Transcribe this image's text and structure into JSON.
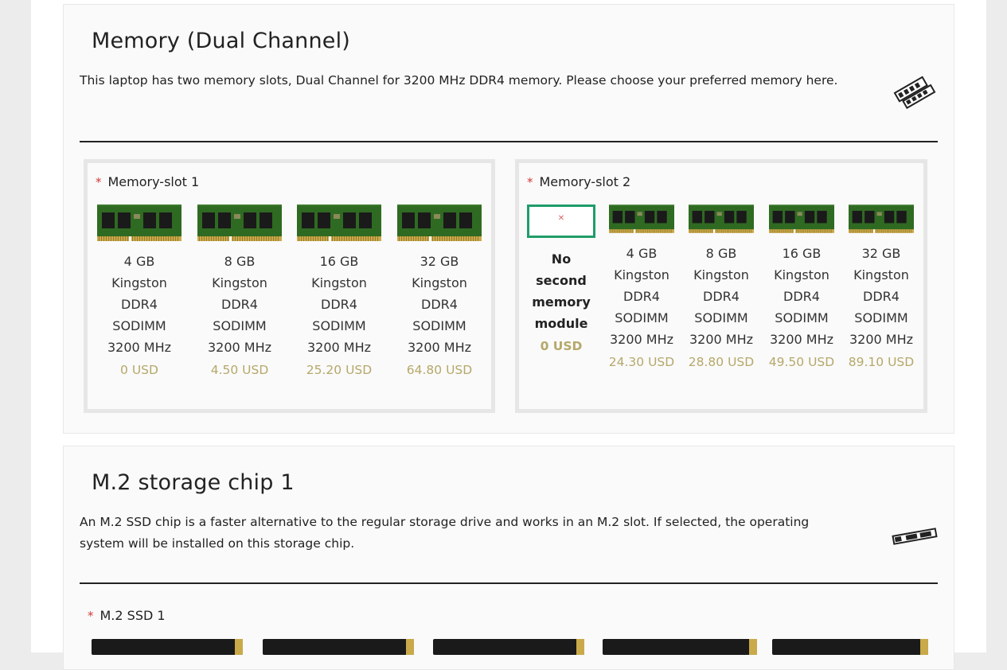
{
  "memory": {
    "title": "Memory (Dual Channel)",
    "description": "This laptop has two memory slots, Dual Channel for 3200 MHz DDR4 memory. Please choose your preferred memory here.",
    "icon": "ram-modules-icon",
    "slot1": {
      "label": "Memory-slot 1",
      "options": [
        {
          "name": "4 GB Kingston DDR4 SODIMM 3200 MHz",
          "price": "0 USD"
        },
        {
          "name": "8 GB Kingston DDR4 SODIMM 3200 MHz",
          "price": "4.50 USD"
        },
        {
          "name": "16 GB Kingston DDR4 SODIMM 3200 MHz",
          "price": "25.20 USD"
        },
        {
          "name": "32 GB Kingston DDR4 SODIMM 3200 MHz",
          "price": "64.80 USD"
        }
      ]
    },
    "slot2": {
      "label": "Memory-slot 2",
      "none_option": {
        "name": "No second memory module",
        "price": "0 USD",
        "selected": true
      },
      "options": [
        {
          "name": "4 GB Kingston DDR4 SODIMM 3200 MHz",
          "price": "24.30 USD"
        },
        {
          "name": "8 GB Kingston DDR4 SODIMM 3200 MHz",
          "price": "28.80 USD"
        },
        {
          "name": "16 GB Kingston DDR4 SODIMM 3200 MHz",
          "price": "49.50 USD"
        },
        {
          "name": "32 GB Kingston DDR4 SODIMM 3200 MHz",
          "price": "89.10 USD"
        }
      ]
    }
  },
  "storage": {
    "title": "M.2 storage chip 1",
    "description": "An M.2 SSD chip is a faster alternative to the regular storage drive and works in an M.2 slot. If selected, the operating system will be installed on this storage chip.",
    "icon": "m2-ssd-icon",
    "slot_label": "M.2 SSD 1"
  },
  "colors": {
    "price": "#b5a86a",
    "selected_border": "#1f9d6a",
    "required": "#d23a3a"
  }
}
